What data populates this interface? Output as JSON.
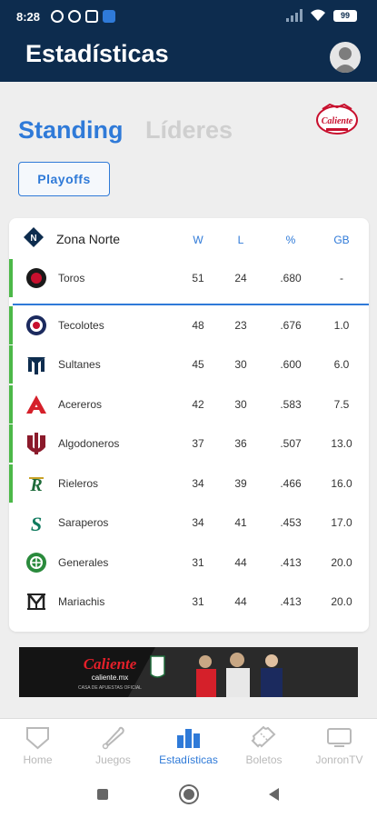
{
  "status_bar": {
    "time": "8:28",
    "battery": "99"
  },
  "header": {
    "title": "Estadísticas"
  },
  "tabs": {
    "standing": "Standing",
    "lideres": "Líderes"
  },
  "playoffs_label": "Playoffs",
  "league_logo_text": "Caliente",
  "zone": {
    "name": "Zona Norte",
    "columns": [
      "W",
      "L",
      "%",
      "GB"
    ],
    "teams": [
      {
        "name": "Toros",
        "w": "51",
        "l": "24",
        "pct": ".680",
        "gb": "-",
        "clinched": true,
        "color": "#c8102e"
      },
      {
        "name": "Tecolotes",
        "w": "48",
        "l": "23",
        "pct": ".676",
        "gb": "1.0",
        "clinched": true,
        "color": "#1b2a5e"
      },
      {
        "name": "Sultanes",
        "w": "45",
        "l": "30",
        "pct": ".600",
        "gb": "6.0",
        "clinched": true,
        "color": "#0d2c4e"
      },
      {
        "name": "Acereros",
        "w": "42",
        "l": "30",
        "pct": ".583",
        "gb": "7.5",
        "clinched": true,
        "color": "#d5202a"
      },
      {
        "name": "Algodoneros",
        "w": "37",
        "l": "36",
        "pct": ".507",
        "gb": "13.0",
        "clinched": true,
        "color": "#8b1a2b"
      },
      {
        "name": "Rieleros",
        "w": "34",
        "l": "39",
        "pct": ".466",
        "gb": "16.0",
        "clinched": true,
        "color": "#1e6b3a"
      },
      {
        "name": "Saraperos",
        "w": "34",
        "l": "41",
        "pct": ".453",
        "gb": "17.0",
        "clinched": false,
        "color": "#0f7a5e"
      },
      {
        "name": "Generales",
        "w": "31",
        "l": "44",
        "pct": ".413",
        "gb": "20.0",
        "clinched": false,
        "color": "#2a8a3c"
      },
      {
        "name": "Mariachis",
        "w": "31",
        "l": "44",
        "pct": ".413",
        "gb": "20.0",
        "clinched": false,
        "color": "#222222"
      }
    ]
  },
  "ad": {
    "brand": "Caliente",
    "url": "caliente.mx",
    "tagline": "CASA DE APUESTAS OFICIAL"
  },
  "bottom_nav": [
    {
      "label": "Home",
      "icon": "home-plate-icon"
    },
    {
      "label": "Juegos",
      "icon": "bat-icon"
    },
    {
      "label": "Estadísticas",
      "icon": "bar-chart-icon",
      "active": true
    },
    {
      "label": "Boletos",
      "icon": "ticket-icon"
    },
    {
      "label": "JonronTV",
      "icon": "tv-icon"
    }
  ],
  "colors": {
    "header": "#0d2c4e",
    "accent": "#2f7ad8",
    "clinched": "#4cb848"
  }
}
